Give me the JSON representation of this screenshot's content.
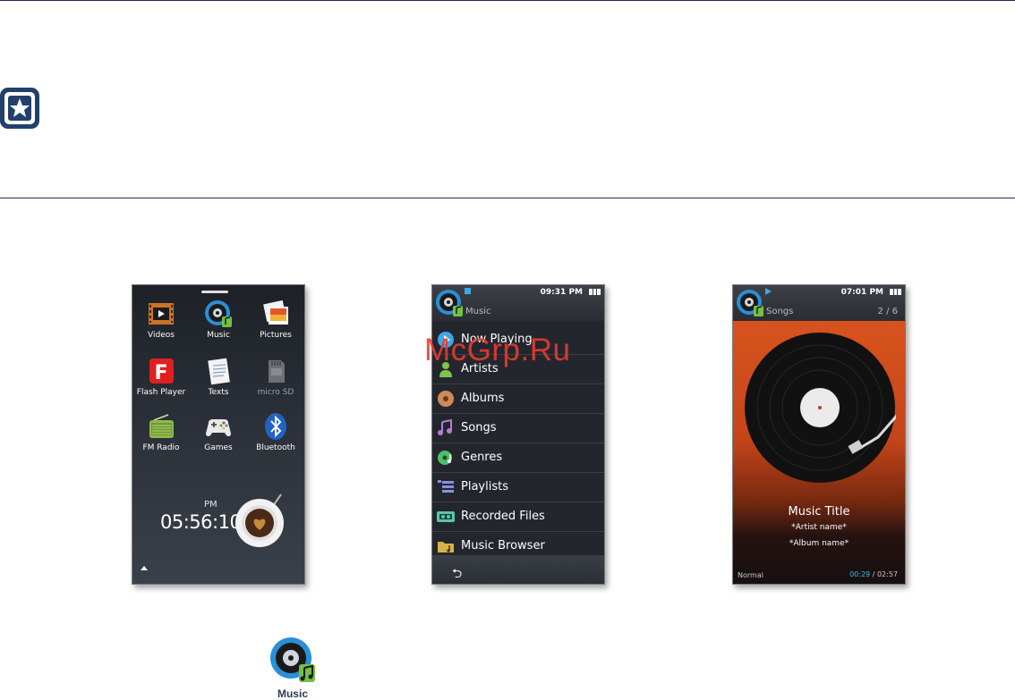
{
  "watermark": "McGrp.Ru",
  "phone_home": {
    "apps": [
      {
        "label": "Videos",
        "icon": "film-icon"
      },
      {
        "label": "Music",
        "icon": "music-disc-icon"
      },
      {
        "label": "Pictures",
        "icon": "photos-icon"
      },
      {
        "label": "Flash Player",
        "icon": "flash-icon"
      },
      {
        "label": "Texts",
        "icon": "text-document-icon"
      },
      {
        "label": "micro SD",
        "icon": "sd-card-icon"
      },
      {
        "label": "FM Radio",
        "icon": "radio-icon"
      },
      {
        "label": "Games",
        "icon": "gamepad-icon"
      },
      {
        "label": "Bluetooth",
        "icon": "bluetooth-icon"
      }
    ],
    "clock_ampm": "PM",
    "clock_time": "05:56:10"
  },
  "phone_menu": {
    "time": "09:31 PM",
    "title": "Music",
    "items": [
      {
        "label": "Now Playing",
        "color": "#3fa7e8"
      },
      {
        "label": "Artists",
        "color": "#7fc24b"
      },
      {
        "label": "Albums",
        "color": "#d08a5a"
      },
      {
        "label": "Songs",
        "color": "#b37ed6"
      },
      {
        "label": "Genres",
        "color": "#4fbf6a"
      },
      {
        "label": "Playlists",
        "color": "#8a8fe0"
      },
      {
        "label": "Recorded Files",
        "color": "#58c7a8"
      },
      {
        "label": "Music Browser",
        "color": "#d6b24a"
      }
    ]
  },
  "phone_player": {
    "time": "07:01 PM",
    "title": "Songs",
    "count": "2 / 6",
    "song_title": "Music Title",
    "artist": "*Artist name*",
    "album": "*Album name*",
    "mode": "Normal",
    "elapsed": "00:29",
    "total": "02:57"
  },
  "music_icon_label": "Music"
}
